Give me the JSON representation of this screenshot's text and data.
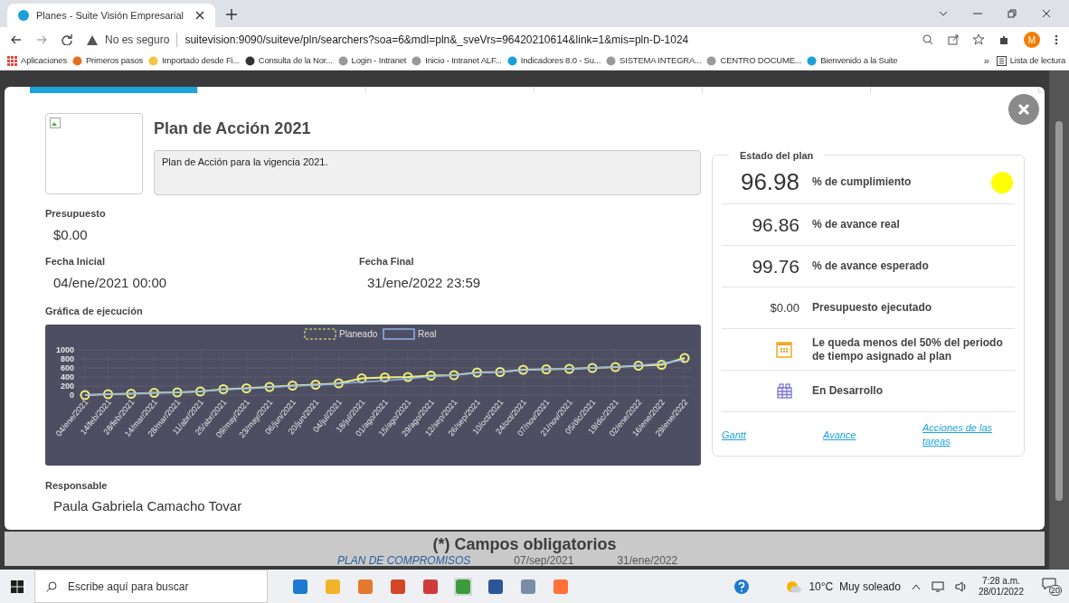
{
  "browser": {
    "tabs": [
      {
        "title": "Planes - Suite Visión Empresarial",
        "selected": true
      }
    ],
    "address": {
      "security": "No es seguro",
      "url": "suitevision:9090/suiteve/pln/searchers?soa=6&mdl=pln&_sveVrs=96420210614&link=1&mis=pln-D-1024"
    },
    "bookmarks": [
      "Aplicaciones",
      "Primeros pasos",
      "Importado desde Fi...",
      "Consulta de la Nor...",
      "Login - Intranet",
      "Inicio - Intranet ALF...",
      "Indicadores 8.0 - Su...",
      "SISTEMA INTEGRA...",
      "CENTRO DOCUME...",
      "Bienvenido a la Suite"
    ],
    "more": "»",
    "reading_list": "Lista de lectura",
    "profile": "M"
  },
  "modal": {
    "section_tabs": [
      {
        "selected": true
      },
      {
        "selected": false
      },
      {
        "selected": false
      },
      {
        "selected": false
      },
      {
        "selected": false
      },
      {
        "selected": false
      }
    ],
    "title": "Plan de Acción 2021",
    "description": "Plan de Acción para la vigencia 2021.",
    "budget": {
      "label": "Presupuesto",
      "value": "$0.00"
    },
    "start": {
      "label": "Fecha Inicial",
      "value": "04/ene/2021 00:00"
    },
    "end": {
      "label": "Fecha Final",
      "value": "31/ene/2022 23:59"
    },
    "chart_title": "Gráfica de ejecución",
    "chart_data": {
      "type": "line",
      "categories": [
        "04/ene/2021",
        "14/feb/2021",
        "28/feb/2021",
        "14/mar/2021",
        "28/mar/2021",
        "11/abr/2021",
        "25/abr/2021",
        "09/may/2021",
        "23/may/2021",
        "06/jun/2021",
        "20/jun/2021",
        "04/jul/2021",
        "18/jul/2021",
        "01/ago/2021",
        "15/ago/2021",
        "29/ago/2021",
        "12/sep/2021",
        "26/sep/2021",
        "10/oct/2021",
        "24/oct/2021",
        "07/nov/2021",
        "21/nov/2021",
        "05/dic/2021",
        "19/dic/2021",
        "02/ene/2022",
        "16/ene/2022",
        "29/ene/2022"
      ],
      "series": [
        {
          "name": "Planeado",
          "color": "#f0f07a",
          "marker": "circle",
          "values": [
            0,
            20,
            30,
            50,
            60,
            80,
            130,
            150,
            180,
            210,
            230,
            260,
            370,
            390,
            400,
            430,
            440,
            500,
            510,
            560,
            570,
            580,
            600,
            620,
            650,
            670,
            820
          ]
        },
        {
          "name": "Real",
          "color": "#8fb3e8",
          "values": [
            0,
            20,
            30,
            50,
            60,
            80,
            120,
            140,
            170,
            200,
            220,
            250,
            290,
            320,
            360,
            410,
            440,
            490,
            510,
            550,
            570,
            580,
            600,
            620,
            660,
            700,
            780
          ]
        }
      ],
      "yticks": [
        0,
        200,
        400,
        600,
        800,
        1000
      ],
      "ylim": [
        0,
        1000
      ],
      "grid": true,
      "legend": true
    },
    "responsible": {
      "label": "Responsable",
      "value": "Paula Gabriela Camacho Tovar"
    },
    "status": {
      "legend": "Estado del plan",
      "rows": [
        {
          "kind": "big",
          "value": "96.98",
          "label": "% de cumplimiento",
          "color": "#ffff00"
        },
        {
          "kind": "medium",
          "value": "96.86",
          "label": "% de avance real"
        },
        {
          "kind": "medium",
          "value": "99.76",
          "label": "% de avance esperado"
        },
        {
          "kind": "small",
          "value": "$0.00",
          "label": "Presupuesto ejecutado"
        },
        {
          "kind": "calendar",
          "label": "Le queda menos del 50% del periodo de tiempo asignado al plan"
        },
        {
          "kind": "state",
          "label": "En Desarrollo"
        }
      ],
      "links": [
        "Gantt",
        "Avance",
        "Acciones de las tareas"
      ]
    }
  },
  "footer": {
    "note": "(*) Campos obligatorios",
    "background_row": [
      "PLAN DE COMPROMISOS",
      "07/sep/2021",
      "31/ene/2022"
    ]
  },
  "taskbar": {
    "search_placeholder": "Escribe aquí para buscar",
    "weather": "10°C  Muy soleado",
    "time": "7:28 a.m.",
    "date": "28/01/2022",
    "notifications": "20"
  }
}
